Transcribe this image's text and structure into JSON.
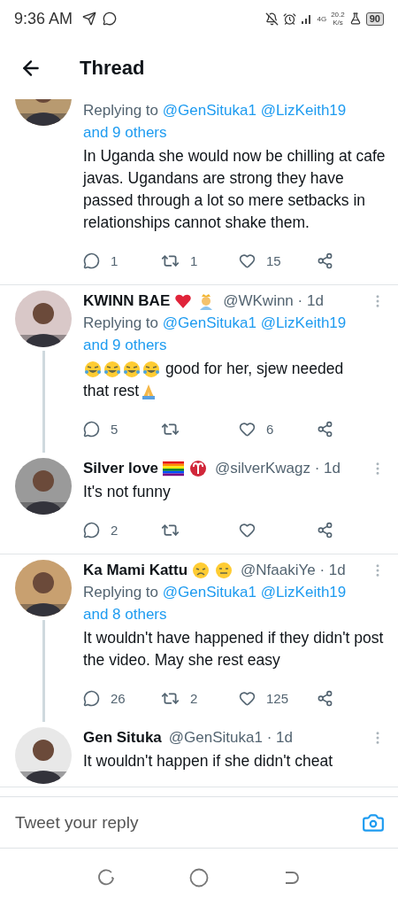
{
  "status_bar": {
    "time": "9:36 AM",
    "network_type": "4G",
    "speed_value": "20.2",
    "speed_unit": "K/s",
    "battery": "90"
  },
  "header": {
    "title": "Thread"
  },
  "tweets": [
    {
      "connected": false,
      "replying": {
        "prefix": "Replying to",
        "mentions": [
          "@GenSituka1",
          "@LizKeith19"
        ],
        "others": "and 9 others"
      },
      "body": [
        {
          "kind": "text",
          "text": "In Uganda she would now be chilling at cafe javas. Ugandans are strong they have passed through a lot so mere setbacks in relationships cannot shake them."
        }
      ],
      "actions": {
        "replies": "1",
        "retweets": "1",
        "likes": "15"
      }
    },
    {
      "connected": true,
      "name": "KWINN BAE",
      "badges": [
        {
          "kind": "heart"
        },
        {
          "kind": "crown"
        }
      ],
      "meta": "@WKwinn · 1d",
      "replying": {
        "prefix": "Replying to",
        "mentions": [
          "@GenSituka1",
          "@LizKeith19"
        ],
        "others": "and 9 others"
      },
      "body": [
        {
          "kind": "laugh"
        },
        {
          "kind": "laugh"
        },
        {
          "kind": "laugh"
        },
        {
          "kind": "laugh"
        },
        {
          "kind": "text",
          "text": " good for her, sjew needed"
        },
        {
          "kind": "text",
          "text": "that rest"
        },
        {
          "kind": "pray"
        }
      ],
      "actions": {
        "replies": "5",
        "likes": "6"
      }
    },
    {
      "connected": false,
      "name": "Silver love",
      "badges": [
        {
          "kind": "rainbow"
        },
        {
          "kind": "aries"
        }
      ],
      "meta": "@silverKwagz · 1d",
      "body": [
        {
          "kind": "text",
          "text": "It's not funny"
        }
      ],
      "actions": {
        "replies": "2"
      }
    },
    {
      "connected": true,
      "name": "Ka Mami Kattu",
      "badges": [
        {
          "kind": "sad"
        },
        {
          "kind": "blank"
        }
      ],
      "meta": "@NfaakiYe · 1d",
      "replying": {
        "prefix": "Replying to",
        "mentions": [
          "@GenSituka1",
          "@LizKeith19"
        ],
        "others": "and 8 others"
      },
      "body": [
        {
          "kind": "text",
          "text": "It wouldn't have happened if they didn't post the video. May she rest easy"
        }
      ],
      "actions": {
        "replies": "26",
        "retweets": "2",
        "likes": "125"
      }
    },
    {
      "connected": false,
      "name": "Gen Situka",
      "meta": "@GenSituka1 · 1d",
      "body": [
        {
          "kind": "text",
          "text": "It wouldn't happen if she didn't cheat"
        }
      ]
    }
  ],
  "reply_bar": {
    "placeholder": "Tweet your reply"
  }
}
